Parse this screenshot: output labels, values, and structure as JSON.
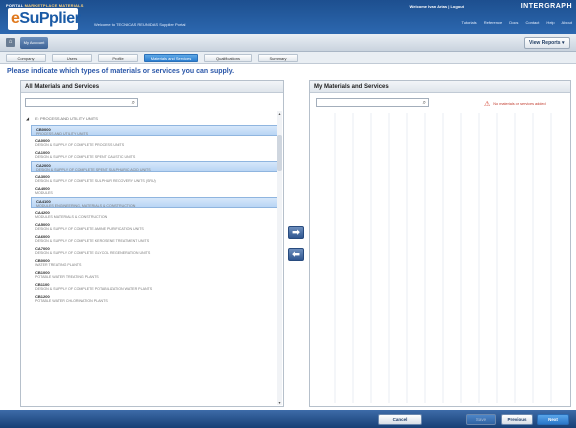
{
  "header": {
    "portal_prefix": "PORTAL",
    "portal_name": "MARKETPLACE MATERIALS",
    "logo_e": "e",
    "logo_rest": "SuPplier",
    "welcome_portal": "Welcome to TECNICAS REUNIDAS Supplier Portal",
    "welcome_user": "Welcome Ivan Arias | Logout",
    "brand": "INTERGRAPH",
    "links": "Tutorials Reference Docs Contact Help About"
  },
  "account_bar": {
    "home_icon": "home-icon",
    "tab_label": "My Account",
    "reports_label": "View Reports"
  },
  "steps": [
    {
      "label": "Company"
    },
    {
      "label": "Users"
    },
    {
      "label": "Profile"
    },
    {
      "label": "Materials and Services"
    },
    {
      "label": "Qualifications"
    },
    {
      "label": "Summary"
    }
  ],
  "question": "Please indicate which types of materials or services you can supply.",
  "left_panel": {
    "title": "All Materials and Services",
    "search_value": "",
    "root": "E: PROCESS AND UTILITY UNITS",
    "items": [
      {
        "code": "CB0000",
        "desc": "PROCESS AND UTILITY UNITS"
      },
      {
        "code": "CA0000",
        "desc": "DESIGN & SUPPLY OF COMPLETE PROCESS UNITS"
      },
      {
        "code": "CA1000",
        "desc": "DESIGN & SUPPLY OF COMPLETE SPENT CAUSTIC UNITS"
      },
      {
        "code": "CA2000",
        "desc": "DESIGN & SUPPLY OF COMPLETE SPENT SULPHURIC ACID UNITS"
      },
      {
        "code": "CA3000",
        "desc": "DESIGN & SUPPLY OF COMPLETE SULPHUR RECOVERY UNITS (SRU)"
      },
      {
        "code": "CA4000",
        "desc": "MODULES"
      },
      {
        "code": "CA4100",
        "desc": "MODULES ENGINEERING, MATERIALS & CONSTRUCTION"
      },
      {
        "code": "CA4200",
        "desc": "MODULES MATERIALS & CONSTRUCTION"
      },
      {
        "code": "CA5000",
        "desc": "DESIGN & SUPPLY OF COMPLETE AMINE PURIFICATION UNITS"
      },
      {
        "code": "CA6000",
        "desc": "DESIGN & SUPPLY OF COMPLETE KEROSENE TREATMENT UNITS"
      },
      {
        "code": "CA7000",
        "desc": "DESIGN & SUPPLY OF COMPLETE GLYCOL REGENERATION UNITS"
      },
      {
        "code": "CB0000",
        "desc": "WATER TREATING PLANTS"
      },
      {
        "code": "CB1000",
        "desc": "POTABLE WATER TREATING PLANTS"
      },
      {
        "code": "CB1100",
        "desc": "DESIGN & SUPPLY OF COMPLETE POTABILIZATION WATER PLANTS"
      },
      {
        "code": "CB1200",
        "desc": "POTABLE WATER CHLORINATION PLANTS"
      }
    ],
    "selected_index": [
      0,
      3,
      6
    ]
  },
  "right_panel": {
    "title": "My Materials and Services",
    "search_value": "",
    "warning": "No materials or services added"
  },
  "transfer": {
    "add_label": "➡",
    "remove_label": "⬅"
  },
  "footer": {
    "cancel_label": "Cancel Registration",
    "save_label": "Save",
    "previous_label": "Previous",
    "next_label": "Next"
  }
}
